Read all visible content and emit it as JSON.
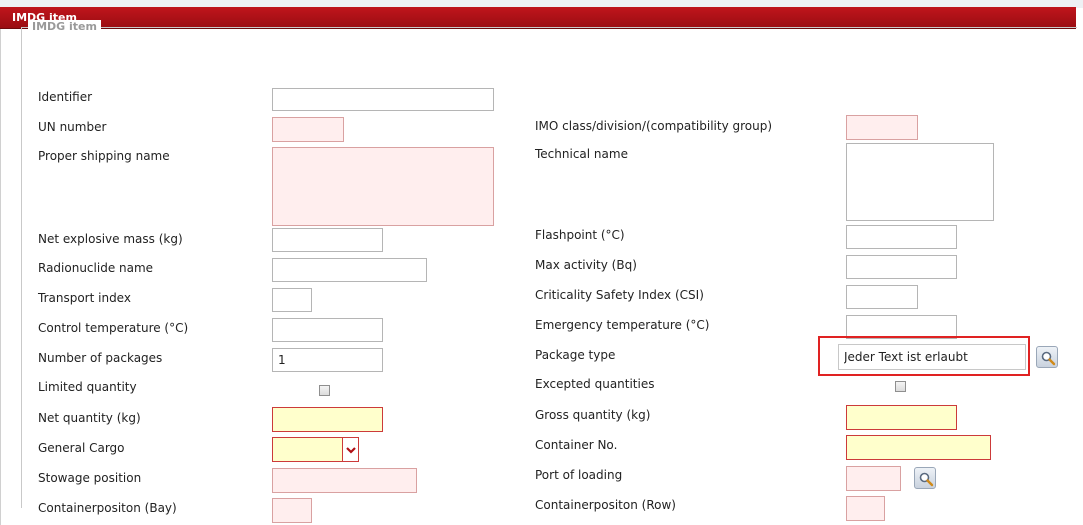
{
  "window": {
    "title": "IMDG item"
  },
  "fieldset": {
    "legend": "IMDG item"
  },
  "labels": {
    "identifier": "Identifier",
    "un_number": "UN number",
    "proper_shipping_name": "Proper shipping name",
    "net_explosive_mass": "Net explosive mass (kg)",
    "radionuclide_name": "Radionuclide name",
    "transport_index": "Transport index",
    "control_temperature": "Control temperature (°C)",
    "number_of_packages": "Number of packages",
    "limited_quantity": "Limited quantity",
    "net_quantity": "Net quantity (kg)",
    "general_cargo": "General Cargo",
    "stowage_position": "Stowage position",
    "containerposition_bay": "Containerpositon (Bay)",
    "imo_class": "IMO class/division/(compatibility group)",
    "technical_name": "Technical name",
    "flashpoint": "Flashpoint (°C)",
    "max_activity": "Max activity (Bq)",
    "csi": "Criticality Safety Index (CSI)",
    "emergency_temperature": "Emergency temperature (°C)",
    "package_type": "Package type",
    "excepted_quantities": "Excepted quantities",
    "gross_quantity": "Gross quantity (kg)",
    "container_no": "Container No.",
    "port_of_loading": "Port of loading",
    "containerposition_row": "Containerpositon (Row)"
  },
  "values": {
    "identifier": "",
    "un_number": "",
    "proper_shipping_name": "",
    "net_explosive_mass": "",
    "radionuclide_name": "",
    "transport_index": "",
    "control_temperature": "",
    "number_of_packages": "1",
    "net_quantity": "",
    "general_cargo": "",
    "stowage_position": "",
    "containerposition_bay": "",
    "imo_class": "",
    "technical_name": "",
    "flashpoint": "",
    "max_activity": "",
    "csi": "",
    "emergency_temperature": "",
    "package_type": "Jeder Text ist erlaubt",
    "gross_quantity": "",
    "container_no": "",
    "port_of_loading": "",
    "containerposition_row": ""
  },
  "checkboxes": {
    "limited_quantity": false,
    "excepted_quantities": false
  },
  "colors": {
    "title_bar": "#b01016",
    "required_field_bg": "#ffeeee",
    "highlight_field_bg": "#ffffcc",
    "annotation_box": "#e02222"
  }
}
